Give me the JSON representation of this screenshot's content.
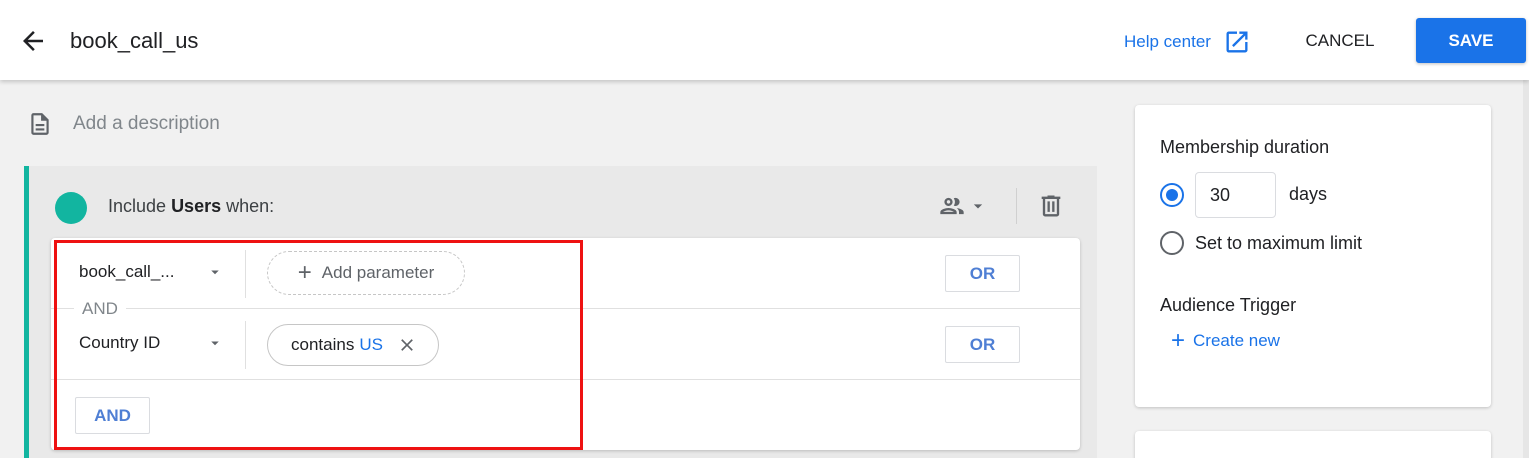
{
  "header": {
    "title": "book_call_us",
    "help_label": "Help center",
    "cancel_label": "CANCEL",
    "save_label": "SAVE"
  },
  "description": {
    "placeholder": "Add a description"
  },
  "condition_group": {
    "prefix": "Include",
    "scope": "Users",
    "suffix": "when:",
    "rows": [
      {
        "dimension": "book_call_...",
        "action": "Add parameter",
        "or_label": "OR"
      },
      {
        "dimension": "Country ID",
        "operator": "contains",
        "value": "US",
        "or_label": "OR"
      }
    ],
    "and_separator": "AND",
    "and_button": "AND"
  },
  "sidebar": {
    "membership_title": "Membership duration",
    "duration_value": "30",
    "duration_unit": "days",
    "max_limit_label": "Set to maximum limit",
    "trigger_title": "Audience Trigger",
    "create_new_label": "Create new"
  },
  "colors": {
    "accent": "#1a73e8",
    "teal": "#12b5a0",
    "highlight": "#ee1111"
  }
}
